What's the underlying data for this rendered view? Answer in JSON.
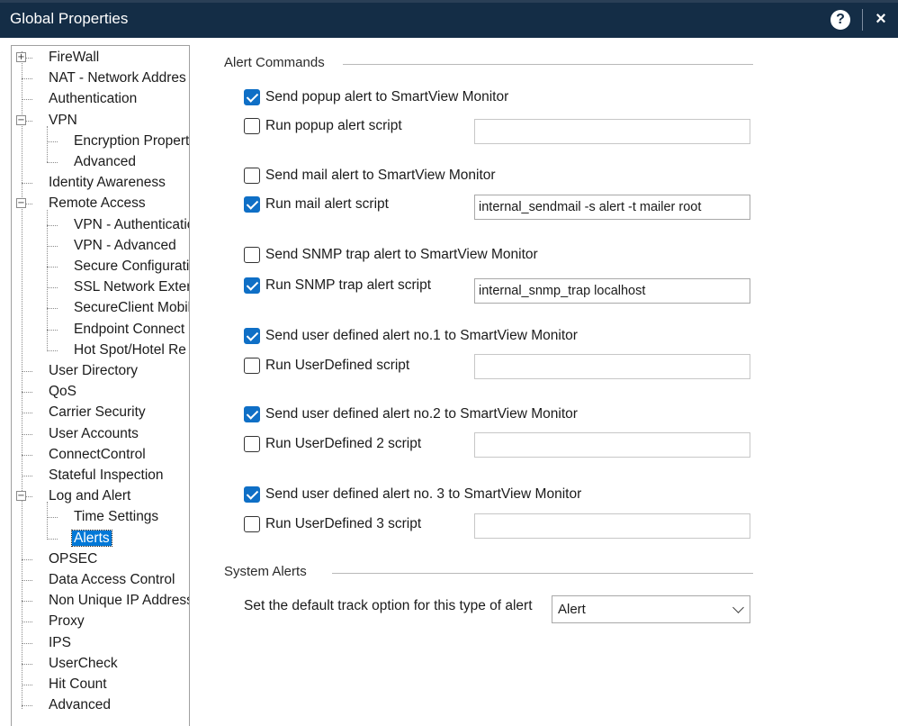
{
  "window": {
    "title": "Global Properties",
    "help_glyph": "?",
    "close_glyph": "×"
  },
  "tree": [
    {
      "label": "FireWall",
      "expander": "+"
    },
    {
      "label": "NAT - Network Addres"
    },
    {
      "label": "Authentication"
    },
    {
      "label": "VPN",
      "expander": "−"
    },
    {
      "label": "Encryption Properti"
    },
    {
      "label": "Advanced"
    },
    {
      "label": "Identity Awareness"
    },
    {
      "label": "Remote Access",
      "expander": "−"
    },
    {
      "label": "VPN - Authenticatio"
    },
    {
      "label": "VPN - Advanced"
    },
    {
      "label": "Secure Configuratio"
    },
    {
      "label": "SSL Network Exter"
    },
    {
      "label": "SecureClient Mobil"
    },
    {
      "label": "Endpoint Connect"
    },
    {
      "label": "Hot Spot/Hotel Re"
    },
    {
      "label": "User Directory"
    },
    {
      "label": "QoS"
    },
    {
      "label": "Carrier Security"
    },
    {
      "label": "User Accounts"
    },
    {
      "label": "ConnectControl"
    },
    {
      "label": "Stateful Inspection"
    },
    {
      "label": "Log and Alert",
      "expander": "−"
    },
    {
      "label": "Time Settings"
    },
    {
      "label": "Alerts",
      "selected": true
    },
    {
      "label": "OPSEC"
    },
    {
      "label": "Data Access Control"
    },
    {
      "label": "Non Unique IP Address"
    },
    {
      "label": "Proxy"
    },
    {
      "label": "IPS"
    },
    {
      "label": "UserCheck"
    },
    {
      "label": "Hit Count"
    },
    {
      "label": "Advanced"
    }
  ],
  "alert_commands": {
    "group_label": "Alert Commands",
    "popup_send": {
      "label": "Send popup alert to SmartView Monitor",
      "checked": true
    },
    "popup_run": {
      "label": "Run popup alert script",
      "checked": false,
      "value": ""
    },
    "mail_send": {
      "label": "Send mail alert to SmartView Monitor",
      "checked": false
    },
    "mail_run": {
      "label": "Run mail alert script",
      "checked": true,
      "value": "internal_sendmail -s alert -t mailer root"
    },
    "snmp_send": {
      "label": "Send SNMP trap alert to SmartView Monitor",
      "checked": false
    },
    "snmp_run": {
      "label": "Run SNMP trap alert script",
      "checked": true,
      "value": "internal_snmp_trap localhost"
    },
    "ud1_send": {
      "label": "Send user defined alert no.1 to SmartView Monitor",
      "checked": true
    },
    "ud1_run": {
      "label": "Run UserDefined script",
      "checked": false,
      "value": ""
    },
    "ud2_send": {
      "label": "Send user defined alert no.2 to SmartView Monitor",
      "checked": true
    },
    "ud2_run": {
      "label": "Run UserDefined 2 script",
      "checked": false,
      "value": ""
    },
    "ud3_send": {
      "label": "Send user defined alert no. 3 to SmartView Monitor",
      "checked": true
    },
    "ud3_run": {
      "label": "Run UserDefined 3 script",
      "checked": false,
      "value": ""
    }
  },
  "system_alerts": {
    "group_label": "System Alerts",
    "track_label": "Set the default track option for this type of alert",
    "track_value": "Alert"
  },
  "colors": {
    "titlebar": "#142d46",
    "checkbox": "#0f6fc6",
    "selection": "#0078d7"
  }
}
